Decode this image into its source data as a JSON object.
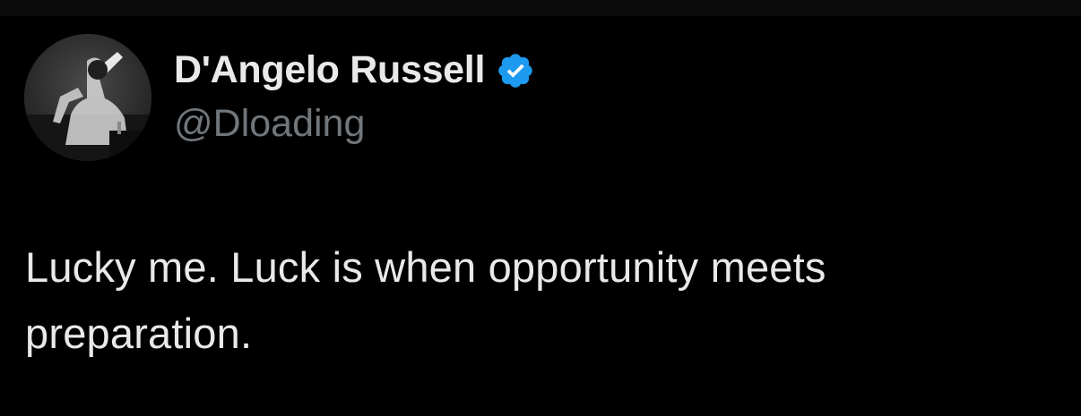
{
  "tweet": {
    "author": {
      "display_name": "D'Angelo Russell",
      "handle": "@Dloading",
      "verified": true,
      "verified_color": "#1d9bf0",
      "avatar_icon": "user-avatar-photo"
    },
    "text": "Lucky me. Luck is when opportunity meets preparation."
  },
  "colors": {
    "background": "#000000",
    "primary_text": "#e7e9ea",
    "secondary_text": "#71767b",
    "accent": "#1d9bf0"
  }
}
